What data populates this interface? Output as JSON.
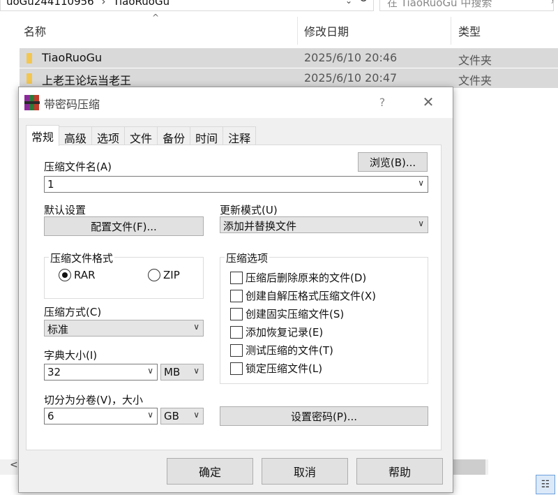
{
  "explorer": {
    "address": {
      "segment_1": "uoGu244110956",
      "segment_2": "TiaoRuoGu"
    },
    "search_placeholder": "在 TiaoRuoGu 中搜索",
    "columns": {
      "name": "名称",
      "modified": "修改日期",
      "type": "类型"
    },
    "files": [
      {
        "name": "TiaoRuoGu",
        "modified": "2025/6/10 20:46",
        "type": "文件夹"
      },
      {
        "name": "上老王论坛当老王",
        "modified": "2025/6/10 20:47",
        "type": "文件夹"
      }
    ]
  },
  "dialog": {
    "title": "带密码压缩",
    "help": "?",
    "close": "✕",
    "tabs": [
      "常规",
      "高级",
      "选项",
      "文件",
      "备份",
      "时间",
      "注释"
    ],
    "active_tab": "常规",
    "archive_name_label": "压缩文件名(A)",
    "archive_name_value": "1",
    "browse_button": "浏览(B)...",
    "default_settings_label": "默认设置",
    "profiles_button": "配置文件(F)...",
    "update_mode_label": "更新模式(U)",
    "update_mode_value": "添加并替换文件",
    "format_group": {
      "title": "压缩文件格式",
      "options": [
        "RAR",
        "ZIP"
      ],
      "selected": "RAR"
    },
    "options_group": {
      "title": "压缩选项",
      "items": [
        {
          "label": "压缩后删除原来的文件(D)",
          "checked": false
        },
        {
          "label": "创建自解压格式压缩文件(X)",
          "checked": false
        },
        {
          "label": "创建固实压缩文件(S)",
          "checked": false
        },
        {
          "label": "添加恢复记录(E)",
          "checked": false
        },
        {
          "label": "测试压缩的文件(T)",
          "checked": false
        },
        {
          "label": "锁定压缩文件(L)",
          "checked": false
        }
      ]
    },
    "method_label": "压缩方式(C)",
    "method_value": "标准",
    "dict_label": "字典大小(I)",
    "dict_value": "32",
    "dict_unit": "MB",
    "split_label": "切分为分卷(V)，大小",
    "split_value": "6",
    "split_unit": "GB",
    "set_password_button": "设置密码(P)...",
    "ok_button": "确定",
    "cancel_button": "取消",
    "help_button": "帮助"
  },
  "colors": {
    "selection": "#d9d9d9",
    "dialog_bg": "#f0f0f0",
    "button_bg": "#e1e1e1",
    "folder": "#f2c651"
  },
  "icons": [
    "folder-icon",
    "refresh-icon",
    "search-icon",
    "winrar-icon",
    "chevron-down-icon",
    "close-icon",
    "list-view-icon"
  ]
}
